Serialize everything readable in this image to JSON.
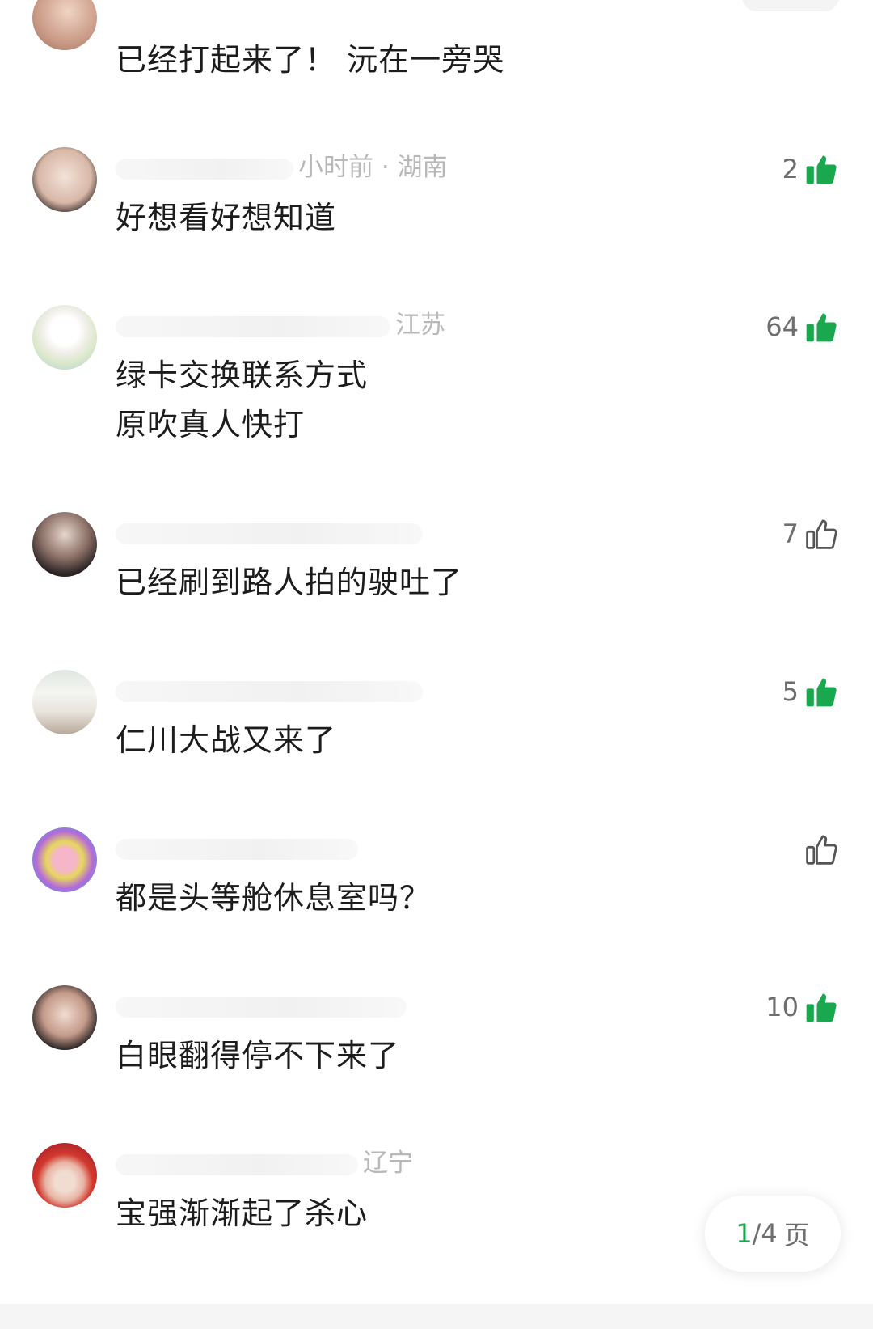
{
  "colors": {
    "accent_green": "#1aa84f",
    "meta_gray": "#b8b8b8",
    "text": "#1c1c1c"
  },
  "comments": [
    {
      "meta": "",
      "lines": [
        "已经打起来了！ 沅在一旁哭"
      ],
      "likes": "",
      "liked": false
    },
    {
      "meta": "小时前 · 湖南",
      "lines": [
        "好想看好想知道"
      ],
      "likes": "2",
      "liked": true
    },
    {
      "meta": "江苏",
      "lines": [
        "绿卡交换联系方式",
        "原吹真人快打"
      ],
      "likes": "64",
      "liked": true
    },
    {
      "meta": "",
      "lines": [
        "已经刷到路人拍的驶吐了"
      ],
      "likes": "7",
      "liked": false
    },
    {
      "meta": "",
      "lines": [
        "仁川大战又来了"
      ],
      "likes": "5",
      "liked": true
    },
    {
      "meta": "",
      "lines": [
        "都是头等舱休息室吗？"
      ],
      "likes": "",
      "liked": false
    },
    {
      "meta": "",
      "lines": [
        "白眼翻得停不下来了"
      ],
      "likes": "10",
      "liked": true
    },
    {
      "meta": "辽宁",
      "lines": [
        "宝强渐渐起了杀心"
      ],
      "likes": "",
      "liked": false
    }
  ],
  "pagination": {
    "current": "1",
    "total": "/4",
    "suffix": "页"
  },
  "icons": {
    "like_filled": "thumbs-up-filled-icon",
    "like_outline": "thumbs-up-outline-icon"
  }
}
